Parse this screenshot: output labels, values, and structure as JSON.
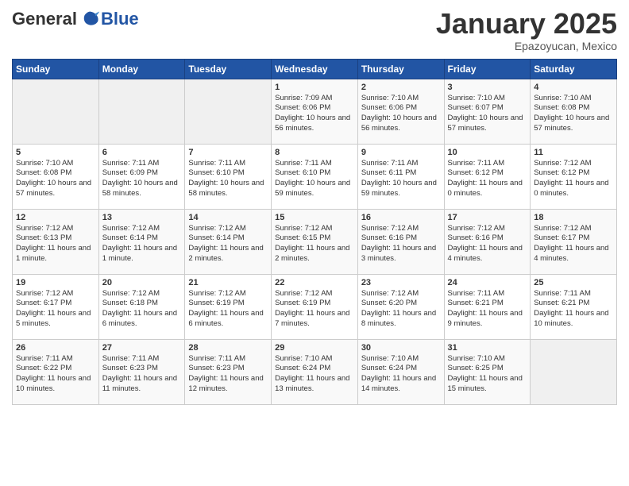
{
  "logo": {
    "general": "General",
    "blue": "Blue"
  },
  "title": "January 2025",
  "location": "Epazoyucan, Mexico",
  "days_of_week": [
    "Sunday",
    "Monday",
    "Tuesday",
    "Wednesday",
    "Thursday",
    "Friday",
    "Saturday"
  ],
  "weeks": [
    [
      {
        "day": "",
        "info": "",
        "empty": true
      },
      {
        "day": "",
        "info": "",
        "empty": true
      },
      {
        "day": "",
        "info": "",
        "empty": true
      },
      {
        "day": "1",
        "info": "Sunrise: 7:09 AM\nSunset: 6:06 PM\nDaylight: 10 hours and 56 minutes.",
        "empty": false
      },
      {
        "day": "2",
        "info": "Sunrise: 7:10 AM\nSunset: 6:06 PM\nDaylight: 10 hours and 56 minutes.",
        "empty": false
      },
      {
        "day": "3",
        "info": "Sunrise: 7:10 AM\nSunset: 6:07 PM\nDaylight: 10 hours and 57 minutes.",
        "empty": false
      },
      {
        "day": "4",
        "info": "Sunrise: 7:10 AM\nSunset: 6:08 PM\nDaylight: 10 hours and 57 minutes.",
        "empty": false
      }
    ],
    [
      {
        "day": "5",
        "info": "Sunrise: 7:10 AM\nSunset: 6:08 PM\nDaylight: 10 hours and 57 minutes.",
        "empty": false
      },
      {
        "day": "6",
        "info": "Sunrise: 7:11 AM\nSunset: 6:09 PM\nDaylight: 10 hours and 58 minutes.",
        "empty": false
      },
      {
        "day": "7",
        "info": "Sunrise: 7:11 AM\nSunset: 6:10 PM\nDaylight: 10 hours and 58 minutes.",
        "empty": false
      },
      {
        "day": "8",
        "info": "Sunrise: 7:11 AM\nSunset: 6:10 PM\nDaylight: 10 hours and 59 minutes.",
        "empty": false
      },
      {
        "day": "9",
        "info": "Sunrise: 7:11 AM\nSunset: 6:11 PM\nDaylight: 10 hours and 59 minutes.",
        "empty": false
      },
      {
        "day": "10",
        "info": "Sunrise: 7:11 AM\nSunset: 6:12 PM\nDaylight: 11 hours and 0 minutes.",
        "empty": false
      },
      {
        "day": "11",
        "info": "Sunrise: 7:12 AM\nSunset: 6:12 PM\nDaylight: 11 hours and 0 minutes.",
        "empty": false
      }
    ],
    [
      {
        "day": "12",
        "info": "Sunrise: 7:12 AM\nSunset: 6:13 PM\nDaylight: 11 hours and 1 minute.",
        "empty": false
      },
      {
        "day": "13",
        "info": "Sunrise: 7:12 AM\nSunset: 6:14 PM\nDaylight: 11 hours and 1 minute.",
        "empty": false
      },
      {
        "day": "14",
        "info": "Sunrise: 7:12 AM\nSunset: 6:14 PM\nDaylight: 11 hours and 2 minutes.",
        "empty": false
      },
      {
        "day": "15",
        "info": "Sunrise: 7:12 AM\nSunset: 6:15 PM\nDaylight: 11 hours and 2 minutes.",
        "empty": false
      },
      {
        "day": "16",
        "info": "Sunrise: 7:12 AM\nSunset: 6:16 PM\nDaylight: 11 hours and 3 minutes.",
        "empty": false
      },
      {
        "day": "17",
        "info": "Sunrise: 7:12 AM\nSunset: 6:16 PM\nDaylight: 11 hours and 4 minutes.",
        "empty": false
      },
      {
        "day": "18",
        "info": "Sunrise: 7:12 AM\nSunset: 6:17 PM\nDaylight: 11 hours and 4 minutes.",
        "empty": false
      }
    ],
    [
      {
        "day": "19",
        "info": "Sunrise: 7:12 AM\nSunset: 6:17 PM\nDaylight: 11 hours and 5 minutes.",
        "empty": false
      },
      {
        "day": "20",
        "info": "Sunrise: 7:12 AM\nSunset: 6:18 PM\nDaylight: 11 hours and 6 minutes.",
        "empty": false
      },
      {
        "day": "21",
        "info": "Sunrise: 7:12 AM\nSunset: 6:19 PM\nDaylight: 11 hours and 6 minutes.",
        "empty": false
      },
      {
        "day": "22",
        "info": "Sunrise: 7:12 AM\nSunset: 6:19 PM\nDaylight: 11 hours and 7 minutes.",
        "empty": false
      },
      {
        "day": "23",
        "info": "Sunrise: 7:12 AM\nSunset: 6:20 PM\nDaylight: 11 hours and 8 minutes.",
        "empty": false
      },
      {
        "day": "24",
        "info": "Sunrise: 7:11 AM\nSunset: 6:21 PM\nDaylight: 11 hours and 9 minutes.",
        "empty": false
      },
      {
        "day": "25",
        "info": "Sunrise: 7:11 AM\nSunset: 6:21 PM\nDaylight: 11 hours and 10 minutes.",
        "empty": false
      }
    ],
    [
      {
        "day": "26",
        "info": "Sunrise: 7:11 AM\nSunset: 6:22 PM\nDaylight: 11 hours and 10 minutes.",
        "empty": false
      },
      {
        "day": "27",
        "info": "Sunrise: 7:11 AM\nSunset: 6:23 PM\nDaylight: 11 hours and 11 minutes.",
        "empty": false
      },
      {
        "day": "28",
        "info": "Sunrise: 7:11 AM\nSunset: 6:23 PM\nDaylight: 11 hours and 12 minutes.",
        "empty": false
      },
      {
        "day": "29",
        "info": "Sunrise: 7:10 AM\nSunset: 6:24 PM\nDaylight: 11 hours and 13 minutes.",
        "empty": false
      },
      {
        "day": "30",
        "info": "Sunrise: 7:10 AM\nSunset: 6:24 PM\nDaylight: 11 hours and 14 minutes.",
        "empty": false
      },
      {
        "day": "31",
        "info": "Sunrise: 7:10 AM\nSunset: 6:25 PM\nDaylight: 11 hours and 15 minutes.",
        "empty": false
      },
      {
        "day": "",
        "info": "",
        "empty": true
      }
    ]
  ]
}
